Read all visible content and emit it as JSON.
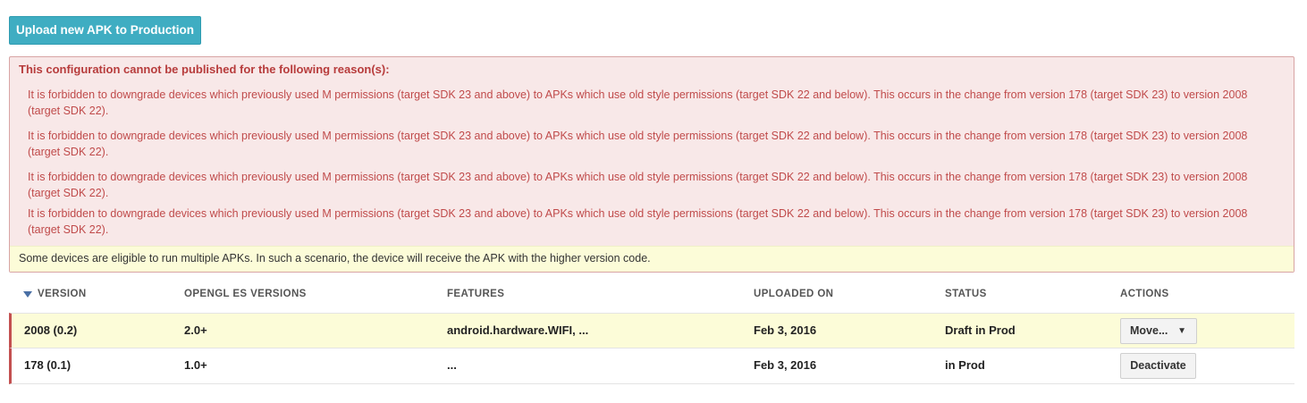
{
  "upload_button": {
    "label": "Upload new APK to Production"
  },
  "error": {
    "title": "This configuration cannot be published for the following reason(s):",
    "messages": [
      "It is forbidden to downgrade devices which previously used M permissions (target SDK 23 and above) to APKs which use old style permissions (target SDK 22 and below). This occurs in the change from version 178 (target SDK 23) to version 2008 (target SDK 22).",
      "It is forbidden to downgrade devices which previously used M permissions (target SDK 23 and above) to APKs which use old style permissions (target SDK 22 and below). This occurs in the change from version 178 (target SDK 23) to version 2008 (target SDK 22).",
      "It is forbidden to downgrade devices which previously used M permissions (target SDK 23 and above) to APKs which use old style permissions (target SDK 22 and below). This occurs in the change from version 178 (target SDK 23) to version 2008 (target SDK 22).",
      "It is forbidden to downgrade devices which previously used M permissions (target SDK 23 and above) to APKs which use old style permissions (target SDK 22 and below). This occurs in the change from version 178 (target SDK 23) to version 2008 (target SDK 22)."
    ],
    "note": "Some devices are eligible to run multiple APKs. In such a scenario, the device will receive the APK with the higher version code."
  },
  "table": {
    "columns": {
      "version": "VERSION",
      "opengl": "OPENGL ES VERSIONS",
      "features": "FEATURES",
      "uploaded": "UPLOADED ON",
      "status": "STATUS",
      "actions": "ACTIONS"
    },
    "rows": [
      {
        "version": "2008 (0.2)",
        "opengl": "2.0+",
        "features": "android.hardware.WIFI, ...",
        "uploaded": "Feb 3, 2016",
        "status": "Draft in Prod",
        "action": "Move...",
        "action_caret": "▼"
      },
      {
        "version": "178 (0.1)",
        "opengl": "1.0+",
        "features": "...",
        "uploaded": "Feb 3, 2016",
        "status": "in Prod",
        "action": "Deactivate"
      }
    ]
  },
  "colors": {
    "primary_button": "#3fadc2",
    "error_background": "#f8e8e8",
    "error_text": "#c04b4b",
    "note_background": "#fcfcd8",
    "row_marker": "#c35050"
  }
}
